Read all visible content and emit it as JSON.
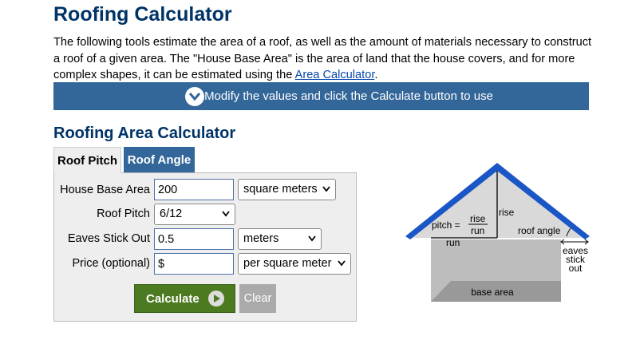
{
  "page": {
    "title": "Roofing Calculator",
    "intro_text": "The following tools estimate the area of a roof, as well as the amount of materials necessary to construct a roof of a given area. The \"House Base Area\" is the area of land that the house covers, and for more complex shapes, it can be estimated using the ",
    "intro_link": "Area Calculator",
    "intro_end": "."
  },
  "banner": {
    "text": "Modify the values and click the Calculate button to use",
    "icon": "chevron-down-icon"
  },
  "calculator": {
    "title": "Roofing Area Calculator",
    "tabs": [
      {
        "label": "Roof Pitch",
        "active": true
      },
      {
        "label": "Roof Angle",
        "active": false
      }
    ],
    "fields": {
      "house_base_area": {
        "label": "House Base Area",
        "value": "200",
        "unit": "square meters"
      },
      "roof_pitch": {
        "label": "Roof Pitch",
        "value": "6/12"
      },
      "eaves": {
        "label": "Eaves Stick Out",
        "value": "0.5",
        "unit": "meters"
      },
      "price": {
        "label": "Price (optional)",
        "value": "$",
        "unit": "per square meter"
      }
    },
    "calculate_label": "Calculate",
    "clear_label": "Clear"
  },
  "diagram": {
    "pitch_label": "pitch =",
    "rise_label": "rise",
    "run_label": "run",
    "rise_side": "rise",
    "run_bottom": "run",
    "roof_angle": "roof angle",
    "eaves_line1": "eaves",
    "eaves_line2": "stick",
    "eaves_line3": "out",
    "base_area": "base area"
  },
  "colors": {
    "title": "#003366",
    "banner": "#336699",
    "calculate": "#4c7a21",
    "clear": "#aaaaaa",
    "roof": "#1a56c6"
  }
}
